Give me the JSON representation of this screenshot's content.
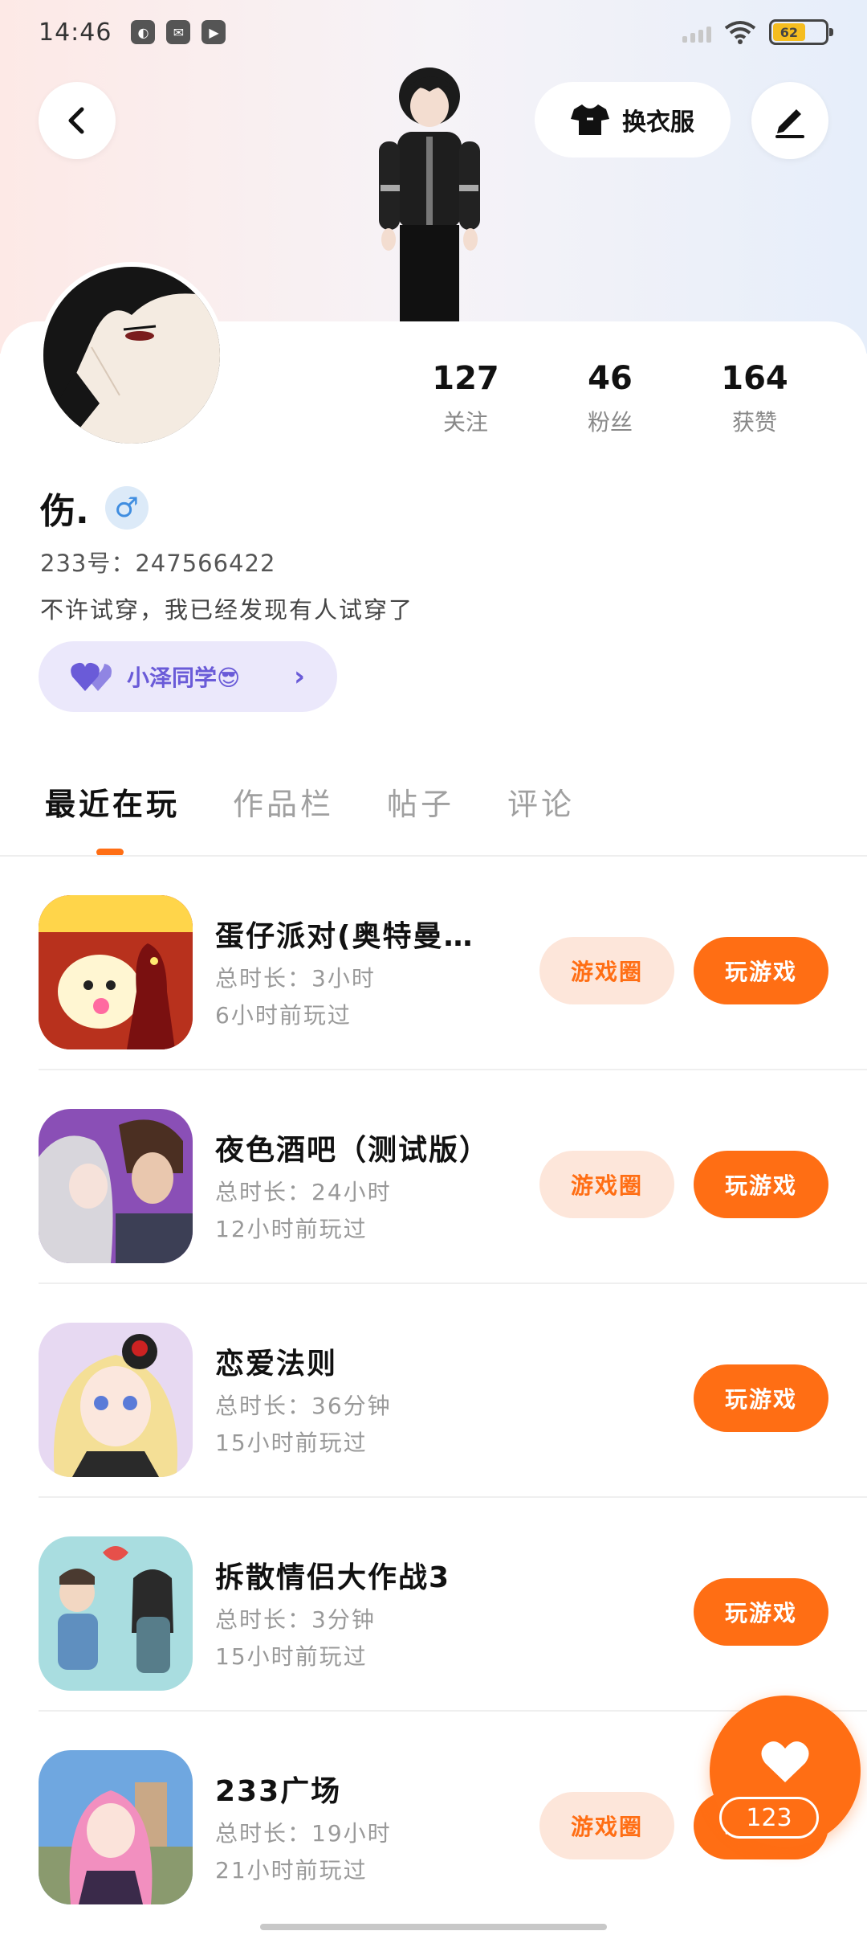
{
  "status_bar": {
    "time": "14:46",
    "battery": "62"
  },
  "header": {
    "outfit_label": "换衣服"
  },
  "profile": {
    "stats": [
      {
        "value": "127",
        "label": "关注"
      },
      {
        "value": "46",
        "label": "粉丝"
      },
      {
        "value": "164",
        "label": "获赞"
      }
    ],
    "nickname": "伤.",
    "gender": "♂",
    "uid": "233号：247566422",
    "bio": "不许试穿，我已经发现有人试穿了",
    "friend_label": "小泽同学😎"
  },
  "tabs": [
    {
      "label": "最近在玩"
    },
    {
      "label": "作品栏"
    },
    {
      "label": "帖子"
    },
    {
      "label": "评论"
    }
  ],
  "games": [
    {
      "title": "蛋仔派对(奥特曼…",
      "duration": "总时长：3小时",
      "last_played": "6小时前玩过",
      "has_circle": true
    },
    {
      "title": "夜色酒吧（测试版）",
      "duration": "总时长：24小时",
      "last_played": "12小时前玩过",
      "has_circle": true
    },
    {
      "title": "恋爱法则",
      "duration": "总时长：36分钟",
      "last_played": "15小时前玩过",
      "has_circle": false
    },
    {
      "title": "拆散情侣大作战3",
      "duration": "总时长：3分钟",
      "last_played": "15小时前玩过",
      "has_circle": false
    },
    {
      "title": "233广场",
      "duration": "总时长：19小时",
      "last_played": "21小时前玩过",
      "has_circle": true
    }
  ],
  "buttons": {
    "game_circle": "游戏圈",
    "play": "玩游戏"
  },
  "like": {
    "count": "123"
  },
  "colors": {
    "accent": "#ff6e14",
    "accent_light": "#fde6da",
    "friend_bg": "#ebe8fb"
  },
  "icons": {
    "back": "chevron-left-icon",
    "outfit": "tshirt-icon",
    "edit": "pen-icon",
    "heart": "heart-icon"
  }
}
